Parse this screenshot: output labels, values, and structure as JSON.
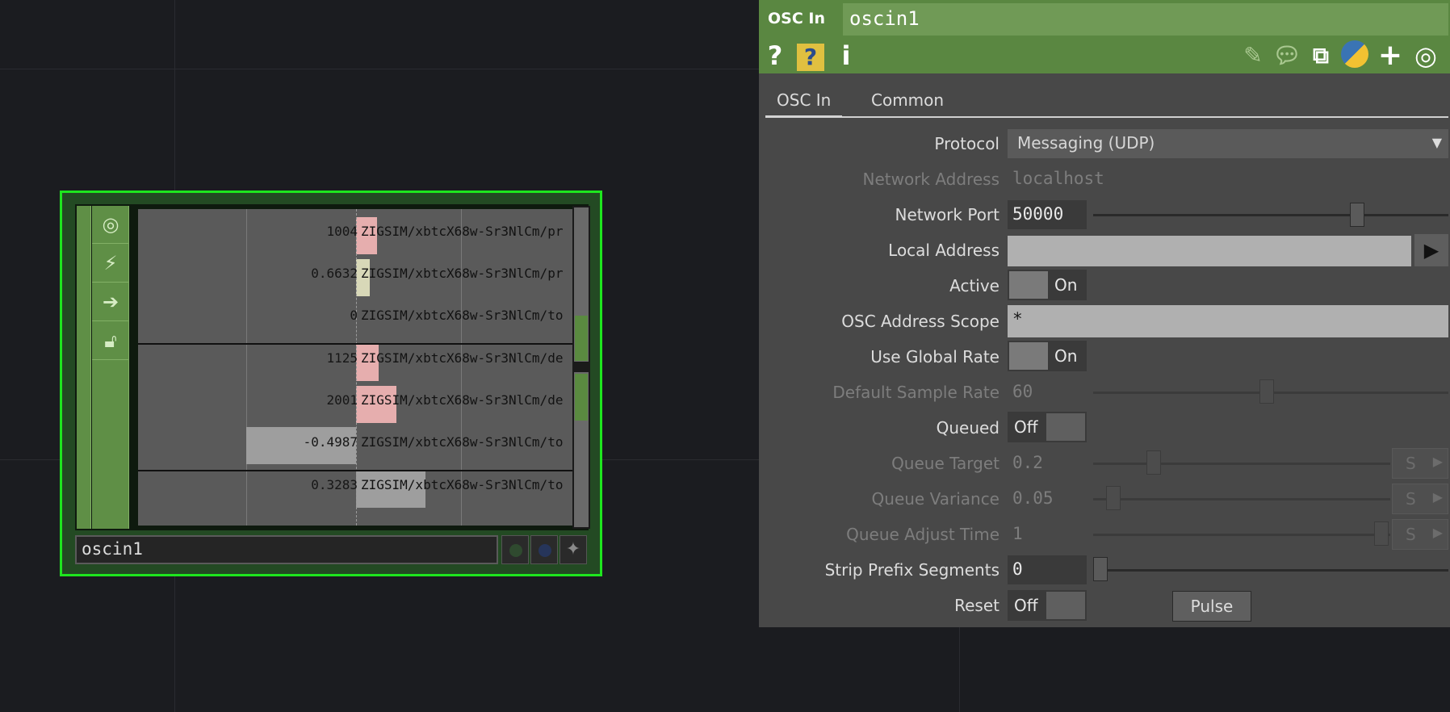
{
  "node": {
    "name": "oscin1",
    "flags": [
      "viewer-icon",
      "bypass-icon",
      "export-icon",
      "lock-icon"
    ],
    "channels": [
      {
        "value": "1004",
        "name": "ZIGSIM/xbtcX68w-Sr3NlCm/pr"
      },
      {
        "value": "0.6632",
        "name": "ZIGSIM/xbtcX68w-Sr3NlCm/pr"
      },
      {
        "value": "0",
        "name": "ZIGSIM/xbtcX68w-Sr3NlCm/to"
      },
      {
        "value": "1125",
        "name": "ZIGSIM/xbtcX68w-Sr3NlCm/de"
      },
      {
        "value": "2001",
        "name": "ZIGSIM/xbtcX68w-Sr3NlCm/de"
      },
      {
        "value": "-0.4987",
        "name": "ZIGSIM/xbtcX68w-Sr3NlCm/to"
      },
      {
        "value": "0.3283",
        "name": "ZIGSIM/xbtcX68w-Sr3NlCm/to"
      }
    ]
  },
  "panel": {
    "op_type": "OSC In",
    "op_name": "oscin1",
    "header_icons": [
      "help-icon",
      "python-help-icon",
      "info-icon",
      "edit-icon",
      "comment-icon",
      "clone-icon",
      "python-icon",
      "add-icon",
      "viewer-target-icon"
    ],
    "tabs": [
      "OSC In",
      "Common"
    ],
    "params": {
      "protocol": {
        "label": "Protocol",
        "value": "Messaging (UDP)"
      },
      "network_address": {
        "label": "Network Address",
        "value": "localhost"
      },
      "network_port": {
        "label": "Network Port",
        "value": "50000"
      },
      "local_address": {
        "label": "Local Address",
        "value": ""
      },
      "active": {
        "label": "Active",
        "value": "On"
      },
      "osc_address_scope": {
        "label": "OSC Address Scope",
        "value": "*"
      },
      "use_global_rate": {
        "label": "Use Global Rate",
        "value": "On"
      },
      "default_sample_rate": {
        "label": "Default Sample Rate",
        "value": "60"
      },
      "queued": {
        "label": "Queued",
        "value": "Off"
      },
      "queue_target": {
        "label": "Queue Target",
        "value": "0.2",
        "unit_btn": "S"
      },
      "queue_variance": {
        "label": "Queue Variance",
        "value": "0.05",
        "unit_btn": "S"
      },
      "queue_adjust_time": {
        "label": "Queue Adjust Time",
        "value": "1",
        "unit_btn": "S"
      },
      "strip_prefix_segments": {
        "label": "Strip Prefix Segments",
        "value": "0"
      },
      "reset": {
        "label": "Reset",
        "value": "Off",
        "pulse": "Pulse"
      }
    }
  },
  "colors": {
    "node_border": "#1ee61e",
    "header_green": "#5a8741",
    "bar_pink": "#e6aeae",
    "bar_cream": "#d8d8b8",
    "bar_gray": "#9e9e9e"
  }
}
